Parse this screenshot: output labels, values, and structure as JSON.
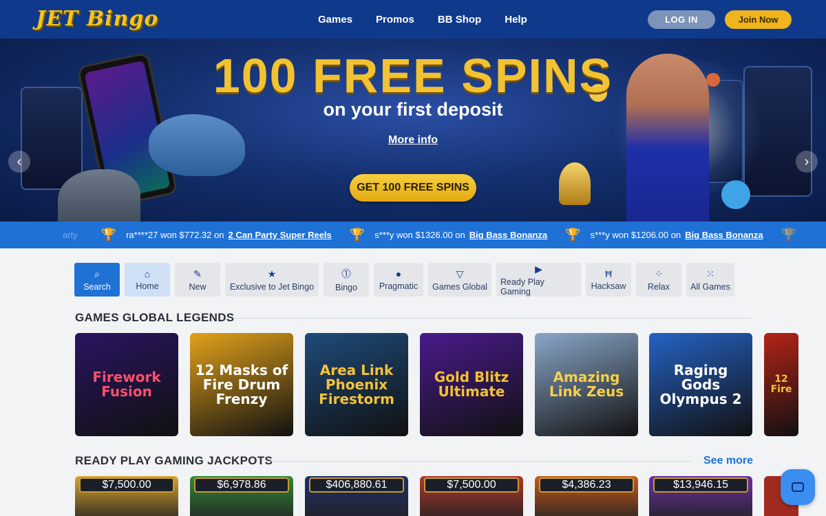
{
  "header": {
    "logo": "JET Bingo",
    "nav": [
      "Games",
      "Promos",
      "BB Shop",
      "Help"
    ],
    "login_label": "LOG IN",
    "join_label": "Join Now"
  },
  "hero": {
    "title": "100 FREE SPINS",
    "subtitle": "on your first deposit",
    "more_info": "More info",
    "cta": "GET 100 FREE SPINS",
    "prev_arrow": "‹",
    "next_arrow": "›"
  },
  "ticker": {
    "faded_prefix": "arty",
    "items": [
      {
        "text": "ra****27 won $772.32 on",
        "game": "2 Can Party Super Reels"
      },
      {
        "text": "s***y won $1326.00 on",
        "game": "Big Bass Bonanza"
      },
      {
        "text": "s***y won $1206.00 on",
        "game": "Big Bass Bonanza"
      }
    ]
  },
  "categories": [
    {
      "label": "Search",
      "icon": "search-icon",
      "glyph": "⌕"
    },
    {
      "label": "Home",
      "icon": "home-icon",
      "glyph": "⌂"
    },
    {
      "label": "New",
      "icon": "tag-icon",
      "glyph": "✎"
    },
    {
      "label": "Exclusive to Jet Bingo",
      "icon": "star-icon",
      "glyph": "★"
    },
    {
      "label": "Bingo",
      "icon": "bingo-ball-icon",
      "glyph": "⓵"
    },
    {
      "label": "Pragmatic",
      "icon": "pragmatic-icon",
      "glyph": "●"
    },
    {
      "label": "Games Global",
      "icon": "games-global-icon",
      "glyph": "▽"
    },
    {
      "label": "Ready Play Gaming",
      "icon": "ready-play-icon",
      "glyph": "▶"
    },
    {
      "label": "Hacksaw",
      "icon": "hacksaw-icon",
      "glyph": "Ħ"
    },
    {
      "label": "Relax",
      "icon": "relax-icon",
      "glyph": "⁘"
    },
    {
      "label": "All Games",
      "icon": "all-games-icon",
      "glyph": "⁙"
    }
  ],
  "section1": {
    "title": "GAMES GLOBAL LEGENDS",
    "games": [
      {
        "name": "Firework Fusion",
        "bg": "#2a1460",
        "fg": "#ff4f6e"
      },
      {
        "name": "12 Masks of Fire Drum Frenzy",
        "bg": "#e2a21b",
        "fg": "#ffffff"
      },
      {
        "name": "Area Link Phoenix Firestorm",
        "bg": "#1e4b7a",
        "fg": "#f7c23a"
      },
      {
        "name": "Gold Blitz Ultimate",
        "bg": "#4a1a8c",
        "fg": "#f2c233"
      },
      {
        "name": "Amazing Link Zeus",
        "bg": "#8aa7c9",
        "fg": "#f7d04a"
      },
      {
        "name": "Raging Gods Olympus 2",
        "bg": "#2562c4",
        "fg": "#ffffff"
      },
      {
        "name": "12 Fire",
        "bg": "#b42418",
        "fg": "#f7c23a"
      }
    ]
  },
  "section2": {
    "title": "READY PLAY GAMING JACKPOTS",
    "see_more": "See more",
    "jackpots": [
      {
        "amount": "$7,500.00",
        "bg": "#d7a52d"
      },
      {
        "amount": "$6,978.86",
        "bg": "#2f8a3a"
      },
      {
        "amount": "$406,880.61",
        "bg": "#1e2f6a"
      },
      {
        "amount": "$7,500.00",
        "bg": "#b0372b"
      },
      {
        "amount": "$4,386.23",
        "bg": "#c75a1a"
      },
      {
        "amount": "$13,946.15",
        "bg": "#6a2fa0"
      }
    ]
  }
}
